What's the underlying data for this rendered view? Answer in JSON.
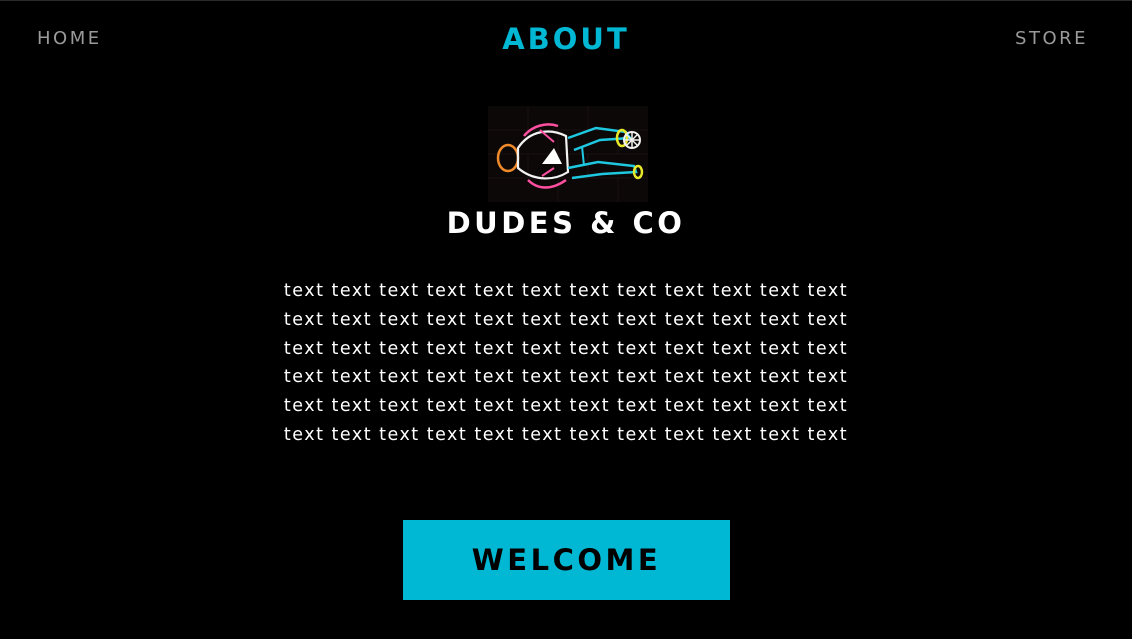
{
  "nav": {
    "home_label": "HOME",
    "title": "ABOUT",
    "store_label": "STORE"
  },
  "logo": {
    "icon": "neon-dude-logo"
  },
  "brand": {
    "name": "DUDES & CO"
  },
  "body": {
    "lines": [
      "text text text text text text text text text text text text",
      "text text text text text text text text text text text text",
      "text text text text text text text text text text text text",
      "text text text text text text text text text text text text",
      "text text text text text text text text text text text text",
      "text text text text text text text text text text text text"
    ]
  },
  "cta": {
    "label": "WELCOME"
  },
  "colors": {
    "background": "#000000",
    "accent": "#00b8d4",
    "nav_text": "#9a9a9a",
    "text": "#ffffff"
  }
}
